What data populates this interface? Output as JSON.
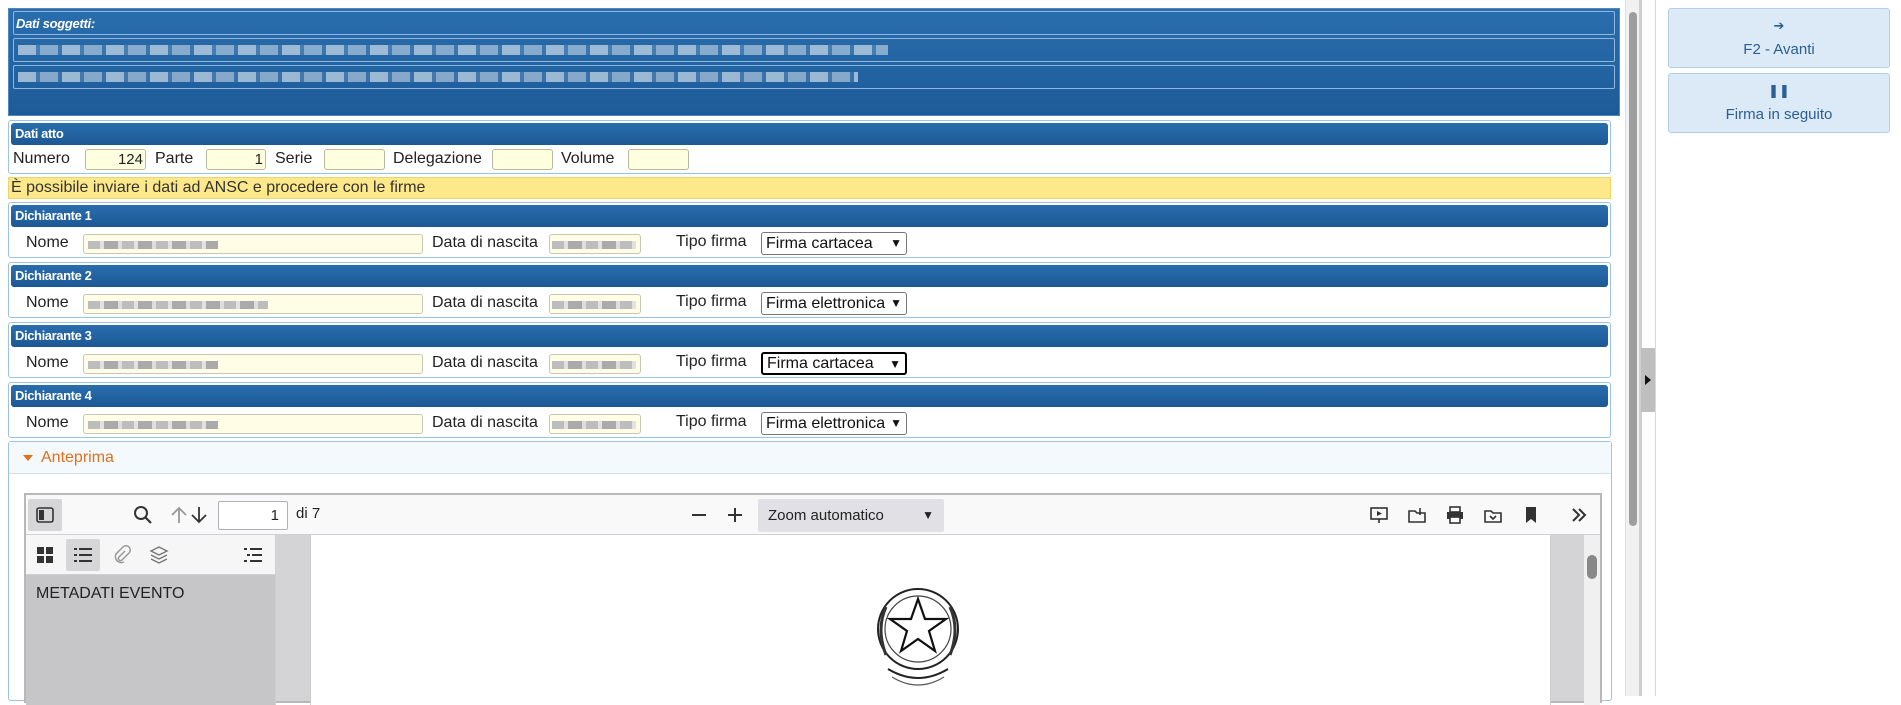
{
  "soggetti": {
    "title": "Dati soggetti:"
  },
  "atto": {
    "title": "Dati atto",
    "fields": {
      "numero_label": "Numero",
      "numero_value": "124",
      "parte_label": "Parte",
      "parte_value": "1",
      "serie_label": "Serie",
      "serie_value": "",
      "delegazione_label": "Delegazione",
      "delegazione_value": "",
      "volume_label": "Volume",
      "volume_value": ""
    }
  },
  "notice": "È possibile inviare i dati ad ANSC e procedere con le firme",
  "dichiaranti": [
    {
      "title": "Dichiarante 1",
      "nome_label": "Nome",
      "data_label": "Data di nascita",
      "tipo_label": "Tipo firma",
      "tipo_value": "Firma cartacea"
    },
    {
      "title": "Dichiarante 2",
      "nome_label": "Nome",
      "data_label": "Data di nascita",
      "tipo_label": "Tipo firma",
      "tipo_value": "Firma elettronica"
    },
    {
      "title": "Dichiarante 3",
      "nome_label": "Nome",
      "data_label": "Data di nascita",
      "tipo_label": "Tipo firma",
      "tipo_value": "Firma cartacea"
    },
    {
      "title": "Dichiarante 4",
      "nome_label": "Nome",
      "data_label": "Data di nascita",
      "tipo_label": "Tipo firma",
      "tipo_value": "Firma elettronica"
    }
  ],
  "anteprima": {
    "title": "Anteprima",
    "viewer": {
      "page_current": "1",
      "page_total": "di 7",
      "zoom": "Zoom automatico",
      "outline_item": "METADATI EVENTO"
    }
  },
  "actions": {
    "avanti": {
      "icon": "➔",
      "label": "F2 - Avanti"
    },
    "firma": {
      "icon": "❚❚",
      "label": "Firma in seguito"
    }
  }
}
